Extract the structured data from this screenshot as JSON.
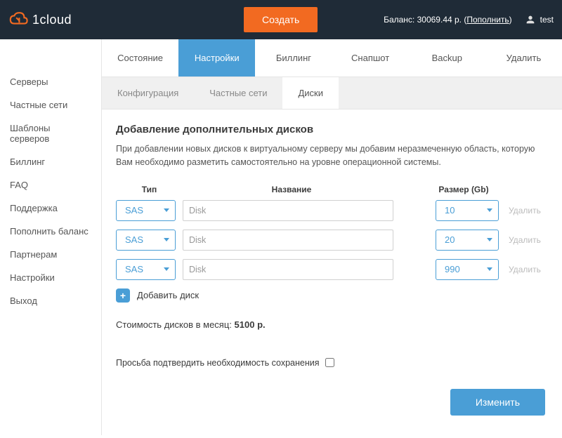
{
  "header": {
    "brand": "1cloud",
    "create_label": "Создать",
    "balance_prefix": "Баланс: ",
    "balance_value": "30069.44 р.",
    "topup_label": "Пополнить",
    "username": "test"
  },
  "sidebar": {
    "items": [
      {
        "label": "Серверы"
      },
      {
        "label": "Частные сети"
      },
      {
        "label": "Шаблоны серверов"
      },
      {
        "label": "Биллинг"
      },
      {
        "label": "FAQ"
      },
      {
        "label": "Поддержка"
      },
      {
        "label": "Пополнить баланс"
      },
      {
        "label": "Партнерам"
      },
      {
        "label": "Настройки"
      },
      {
        "label": "Выход"
      }
    ]
  },
  "tabs": [
    {
      "label": "Состояние"
    },
    {
      "label": "Настройки"
    },
    {
      "label": "Биллинг"
    },
    {
      "label": "Снапшот"
    },
    {
      "label": "Backup"
    },
    {
      "label": "Удалить"
    }
  ],
  "subtabs": [
    {
      "label": "Конфигурация"
    },
    {
      "label": "Частные сети"
    },
    {
      "label": "Диски"
    }
  ],
  "section": {
    "title": "Добавление дополнительных дисков",
    "desc": "При добавлении новых дисков к виртуальному серверу мы добавим неразмеченную область, которую Вам необходимо разметить самостоятельно на уровне операционной системы."
  },
  "columns": {
    "type": "Тип",
    "name": "Название",
    "size": "Размер (Gb)"
  },
  "disks": [
    {
      "type": "SAS",
      "name": "Disk",
      "size": "10",
      "delete": "Удалить"
    },
    {
      "type": "SAS",
      "name": "Disk",
      "size": "20",
      "delete": "Удалить"
    },
    {
      "type": "SAS",
      "name": "Disk",
      "size": "990",
      "delete": "Удалить"
    }
  ],
  "add_disk_label": "Добавить диск",
  "cost": {
    "prefix": "Стоимость дисков в месяц: ",
    "value": "5100 р."
  },
  "confirm_label": "Просьба подтвердить необходимость сохранения",
  "submit_label": "Изменить"
}
